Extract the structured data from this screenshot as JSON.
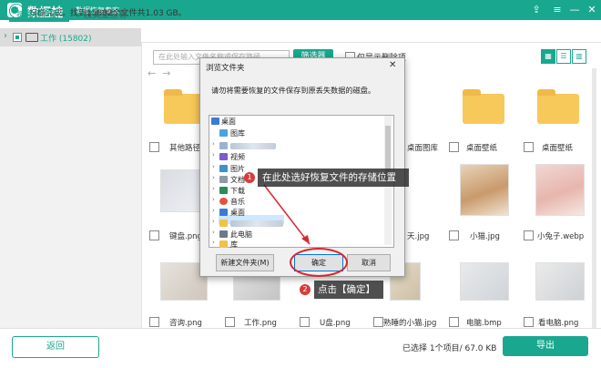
{
  "app": {
    "name": "数据蛙",
    "subtitle": "数据恢复专家"
  },
  "status": {
    "scan_message": "扫描完成。找到15802个文件共1.03 GB。"
  },
  "sidebar": {
    "tabs": [
      {
        "label": "按路径查看"
      },
      {
        "label": "按类型查看"
      }
    ],
    "tree": [
      {
        "label": "工作 (15802)"
      }
    ]
  },
  "toolbar": {
    "search_placeholder": "在此处输入文件名称或保存路径",
    "filter_label": "筛选器",
    "only_deleted_label": "仅显示删除项"
  },
  "files": [
    {
      "name": "其他路径",
      "type": "folder"
    },
    {
      "name": "",
      "type": "folder"
    },
    {
      "name": "",
      "type": "folder"
    },
    {
      "name": "",
      "type": "folder"
    },
    {
      "name": "桌面图库",
      "type": "folder"
    },
    {
      "name": "桌面壁纸",
      "type": "folder"
    },
    {
      "name": "桌面壁纸",
      "type": "folder"
    },
    {
      "name": "键盘.png",
      "type": "image"
    },
    {
      "name": "天.jpg",
      "type": "image"
    },
    {
      "name": "小猫.jpg",
      "type": "image"
    },
    {
      "name": "小兔子.webp",
      "type": "image"
    },
    {
      "name": "咨询.png",
      "type": "image"
    },
    {
      "name": "工作.png",
      "type": "image"
    },
    {
      "name": "U盘.png",
      "type": "image"
    },
    {
      "name": "熟睡的小猫.jpg",
      "type": "image"
    },
    {
      "name": "电脑.bmp",
      "type": "image"
    },
    {
      "name": "看电脑.png",
      "type": "image"
    }
  ],
  "footer": {
    "back_label": "返回",
    "selection_info": "已选择 1个项目/ 67.0 KB",
    "export_label": "导出"
  },
  "dialog": {
    "title": "浏览文件夹",
    "message": "请勿将需要恢复的文件保存到原丢失数据的磁盘。",
    "tree": [
      {
        "label": "桌面"
      },
      {
        "label": "图库"
      },
      {
        "label": ""
      },
      {
        "label": "视频"
      },
      {
        "label": "图片"
      },
      {
        "label": "文档"
      },
      {
        "label": "下载"
      },
      {
        "label": "音乐"
      },
      {
        "label": "桌面"
      },
      {
        "label": ""
      },
      {
        "label": "此电脑"
      },
      {
        "label": "库"
      }
    ],
    "new_folder_label": "新建文件夹(M)",
    "ok_label": "确定",
    "cancel_label": "取消"
  },
  "annotations": [
    {
      "number": "1",
      "text": "在此处选好恢复文件的存储位置"
    },
    {
      "number": "2",
      "text": "点击【确定】"
    }
  ],
  "colors": {
    "accent": "#19a88f",
    "annotation_red": "#d9262f"
  }
}
